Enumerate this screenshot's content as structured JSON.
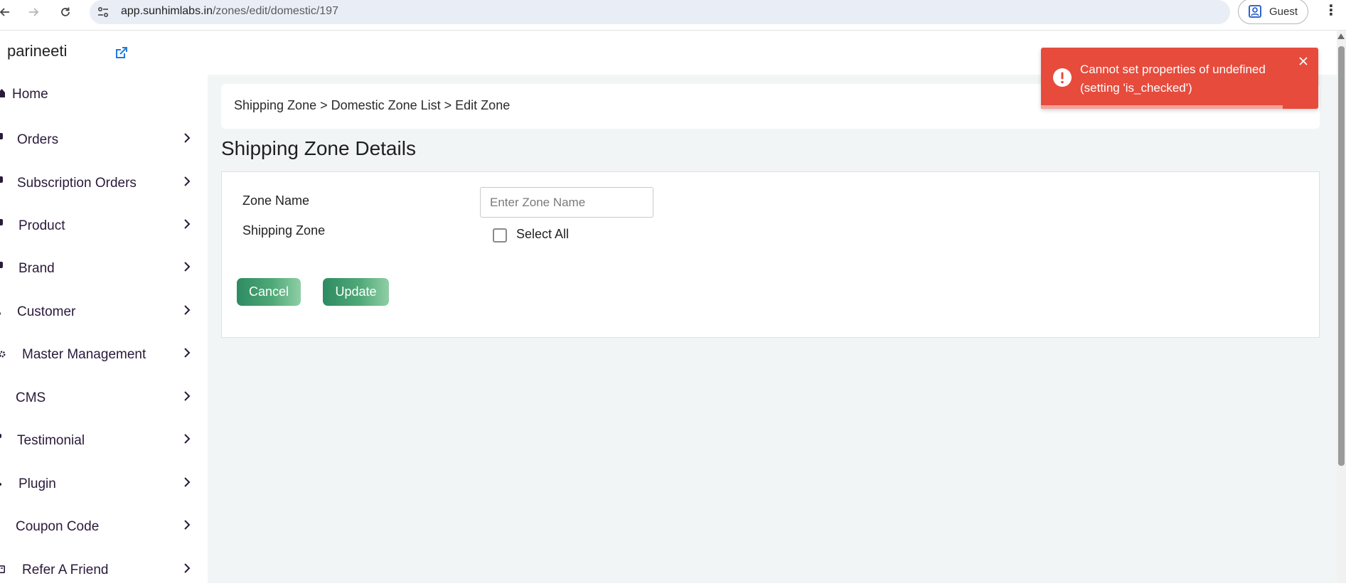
{
  "browser": {
    "url_host": "app.sunhimlabs.in",
    "url_path": "/zones/edit/domestic/197",
    "profile_label": "Guest"
  },
  "header": {
    "brand": "parineeti"
  },
  "sidebar": {
    "items": [
      {
        "label": "Home",
        "icon": "home-icon"
      },
      {
        "label": "Orders",
        "icon": "bullet-icon"
      },
      {
        "label": "Subscription Orders",
        "icon": "bullet-icon"
      },
      {
        "label": "Product",
        "icon": "bullet-icon"
      },
      {
        "label": "Brand",
        "icon": "bullet-icon"
      },
      {
        "label": "Customer",
        "icon": "bullet-icon"
      },
      {
        "label": "Master Management",
        "icon": "gear-icon"
      },
      {
        "label": "CMS",
        "icon": ""
      },
      {
        "label": "Testimonial",
        "icon": "bullet-icon"
      },
      {
        "label": "Plugin",
        "icon": "bullet-icon"
      },
      {
        "label": "Coupon Code",
        "icon": ""
      },
      {
        "label": "Refer A Friend",
        "icon": "bullet-icon"
      }
    ]
  },
  "main": {
    "breadcrumb": "Shipping Zone > Domestic Zone List > Edit Zone",
    "title": "Shipping Zone Details",
    "form": {
      "zone_name_label": "Zone Name",
      "zone_name_value": "",
      "zone_name_placeholder": "Enter Zone Name",
      "shipping_zone_label": "Shipping Zone",
      "select_all_label": "Select All",
      "select_all_checked": false,
      "cancel_label": "Cancel",
      "update_label": "Update"
    }
  },
  "toast": {
    "message": "Cannot set properties of undefined (setting 'is_checked')",
    "type": "error",
    "color": "#e64b3c"
  },
  "colors": {
    "accent": "#2e8b62",
    "sidebar_text": "#2a1a3a",
    "main_bg": "#f2f5f5"
  }
}
